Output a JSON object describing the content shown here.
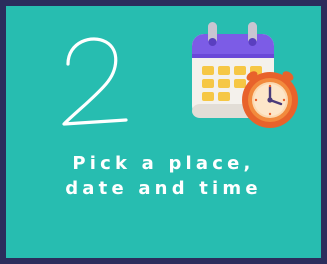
{
  "card": {
    "step_number": "2",
    "caption_line1": "Pick a place,",
    "caption_line2": "date and time",
    "icon": "calendar-clock-icon",
    "colors": {
      "background": "#27bdb0",
      "frame": "#2b2d5c",
      "text": "#ffffff"
    }
  }
}
